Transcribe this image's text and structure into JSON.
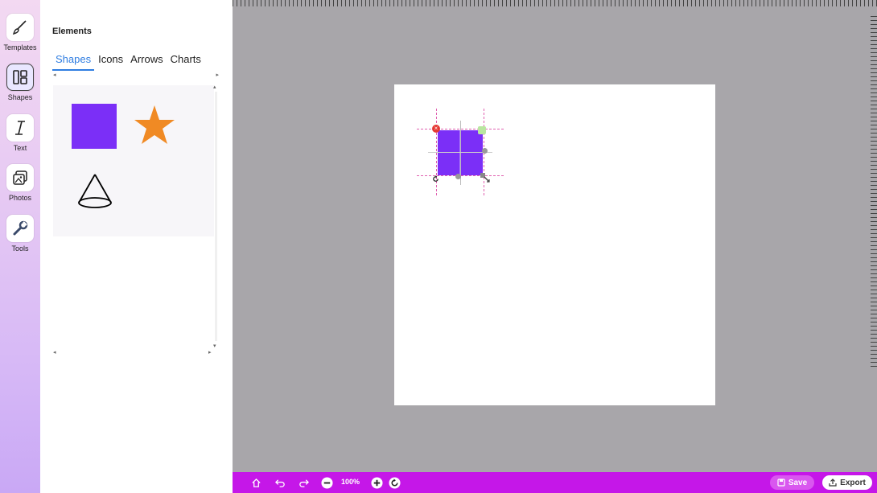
{
  "rail": {
    "items": [
      {
        "label": "Templates",
        "icon": "brush-icon"
      },
      {
        "label": "Shapes",
        "icon": "layout-icon"
      },
      {
        "label": "Text",
        "icon": "text-icon"
      },
      {
        "label": "Photos",
        "icon": "photos-icon"
      },
      {
        "label": "Tools",
        "icon": "wrench-icon"
      }
    ],
    "active": "Shapes"
  },
  "panel": {
    "title": "Elements",
    "tabs": [
      "Shapes",
      "Icons",
      "Arrows",
      "Charts"
    ],
    "active_tab": "Shapes",
    "shapes": [
      {
        "name": "square",
        "color": "#7b2ff7"
      },
      {
        "name": "star",
        "color": "#f08a24"
      },
      {
        "name": "cone",
        "color": "#000000"
      }
    ]
  },
  "canvas": {
    "background": "#a8a6aa",
    "page_color": "#ffffff",
    "selected_shape_color": "#7b2ff7"
  },
  "bottom_bar": {
    "zoom": "100%",
    "save_label": "Save",
    "export_label": "Export",
    "color": "#c517e8"
  }
}
